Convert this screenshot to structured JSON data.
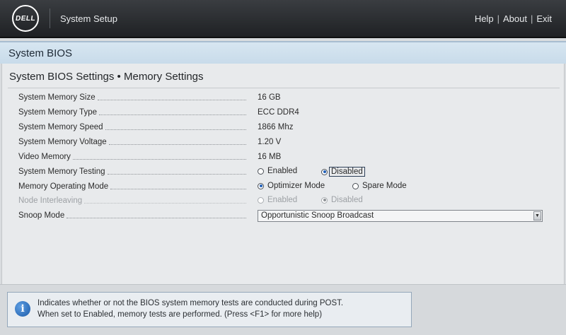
{
  "header": {
    "logo_text": "DELL",
    "app_title": "System Setup",
    "links": [
      "Help",
      "About",
      "Exit"
    ]
  },
  "section_title": "System BIOS",
  "page_title": "System BIOS Settings • Memory Settings",
  "settings": [
    {
      "label": "System Memory Size",
      "value": "16 GB"
    },
    {
      "label": "System Memory Type",
      "value": "ECC DDR4"
    },
    {
      "label": "System Memory Speed",
      "value": "1866 Mhz"
    },
    {
      "label": "System Memory Voltage",
      "value": "1.20 V"
    },
    {
      "label": "Video Memory",
      "value": "16 MB"
    },
    {
      "label": "System Memory Testing",
      "options": [
        "Enabled",
        "Disabled"
      ],
      "selected": "Disabled"
    },
    {
      "label": "Memory Operating Mode",
      "options": [
        "Optimizer Mode",
        "Spare Mode"
      ],
      "selected": "Optimizer Mode"
    },
    {
      "label": "Node Interleaving",
      "options": [
        "Enabled",
        "Disabled"
      ],
      "selected": "Disabled",
      "disabled": true
    },
    {
      "label": "Snoop Mode",
      "value": "Opportunistic Snoop Broadcast"
    }
  ],
  "help": {
    "line1": "Indicates whether or not the BIOS system memory tests are conducted during POST.",
    "line2": "When set to Enabled, memory tests are performed. (Press <F1> for more help)"
  },
  "colors": {
    "accent": "#2261b8",
    "header_bg": "#2b2e32",
    "band_bg": "#d0e1ee"
  }
}
